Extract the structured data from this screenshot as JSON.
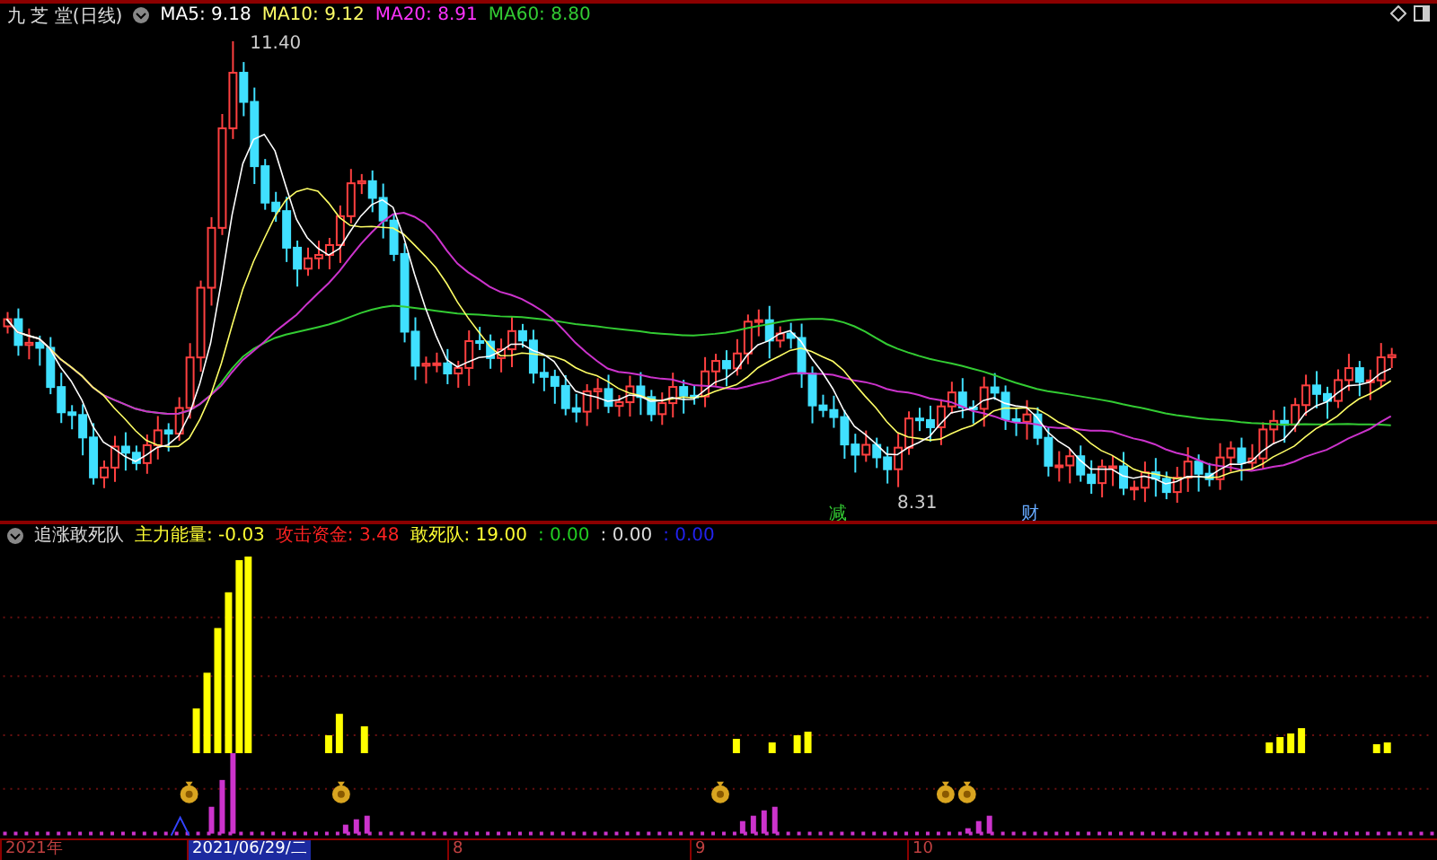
{
  "header": {
    "title": "九 芝 堂(日线)",
    "averages": [
      {
        "label": "MA5: 9.18",
        "color": "#ffffff"
      },
      {
        "label": "MA10: 9.12",
        "color": "#ffff66"
      },
      {
        "label": "MA20: 8.91",
        "color": "#ff33ff"
      },
      {
        "label": "MA60: 8.80",
        "color": "#33cc33"
      }
    ]
  },
  "price_chart": {
    "high_label": "11.40",
    "low_label": "8.31",
    "markers": [
      "减",
      "财"
    ]
  },
  "indicator": {
    "title": "追涨敢死队",
    "values": [
      {
        "label": "主力能量: -0.03",
        "color": "#ffff33"
      },
      {
        "label": "攻击资金: 3.48",
        "color": "#ff2222"
      },
      {
        "label": "敢死队: 19.00",
        "color": "#ffff33"
      },
      {
        "label": ": 0.00",
        "color": "#22cc22"
      },
      {
        "label": ": 0.00",
        "color": "#dddddd"
      },
      {
        "label": ": 0.00",
        "color": "#2222ee"
      }
    ]
  },
  "time_axis": [
    {
      "label": "2021年",
      "selected": false
    },
    {
      "label": "2021/06/29/二",
      "selected": true
    },
    {
      "label": "8",
      "selected": false
    },
    {
      "label": "9",
      "selected": false
    },
    {
      "label": "10",
      "selected": false
    }
  ]
}
